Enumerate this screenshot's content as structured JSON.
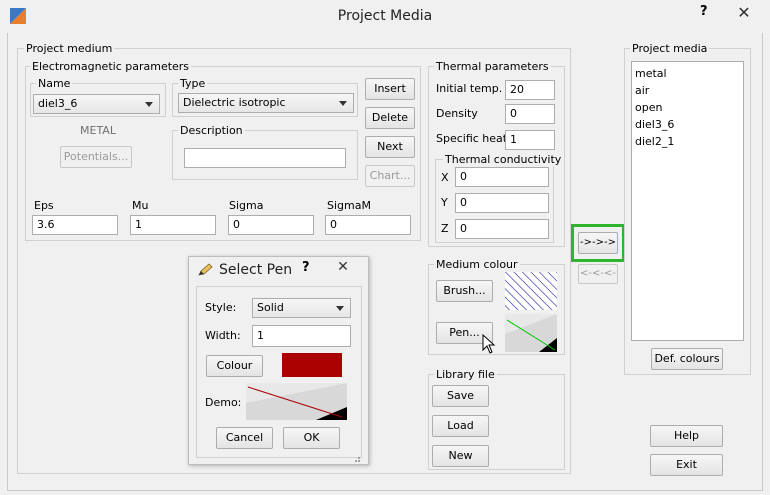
{
  "window": {
    "title": "Project Media",
    "help": "?",
    "close": "✕"
  },
  "project_medium": {
    "label": "Project medium",
    "em": {
      "label": "Electromagnetic parameters",
      "name_label": "Name",
      "name_value": "diel3_6",
      "type_label": "Type",
      "type_value": "Dielectric isotropic",
      "metal_label": "METAL",
      "potentials_btn": "Potentials...",
      "description_label": "Description",
      "description_value": "",
      "insert_btn": "Insert",
      "delete_btn": "Delete",
      "next_btn": "Next",
      "chart_btn": "Chart...",
      "eps_label": "Eps",
      "eps_value": "3.6",
      "mu_label": "Mu",
      "mu_value": "1",
      "sigma_label": "Sigma",
      "sigma_value": "0",
      "sigmam_label": "SigmaM",
      "sigmam_value": "0"
    },
    "thermal": {
      "label": "Thermal parameters",
      "initial_temp_label": "Initial temp.",
      "initial_temp_value": "20",
      "density_label": "Density",
      "density_value": "0",
      "specific_heat_label": "Specific heat",
      "specific_heat_value": "1",
      "conductivity": {
        "label": "Thermal conductivity",
        "x_label": "X",
        "x_value": "0",
        "y_label": "Y",
        "y_value": "0",
        "z_label": "Z",
        "z_value": "0"
      }
    },
    "colour": {
      "label": "Medium colour",
      "brush_btn": "Brush...",
      "pen_btn": "Pen..."
    },
    "library": {
      "label": "Library file",
      "save_btn": "Save",
      "load_btn": "Load",
      "new_btn": "New"
    }
  },
  "transfer": {
    "add_btn": "->->->",
    "remove_btn": "<-<-<-"
  },
  "project_media": {
    "label": "Project media",
    "items": [
      "metal",
      "air",
      "open",
      "diel3_6",
      "diel2_1"
    ],
    "def_colours_btn": "Def. colours"
  },
  "help_btn": "Help",
  "exit_btn": "Exit",
  "select_pen": {
    "title": "Select Pen",
    "help": "?",
    "close": "✕",
    "style_label": "Style:",
    "style_value": "Solid",
    "width_label": "Width:",
    "width_value": "1",
    "colour_btn": "Colour",
    "colour_value": "#aa0000",
    "demo_label": "Demo:",
    "cancel_btn": "Cancel",
    "ok_btn": "OK"
  },
  "colors": {
    "highlight_box": "#2db52d",
    "pen_colour": "#aa0000",
    "brush_hatch": "#1a1aa0"
  }
}
